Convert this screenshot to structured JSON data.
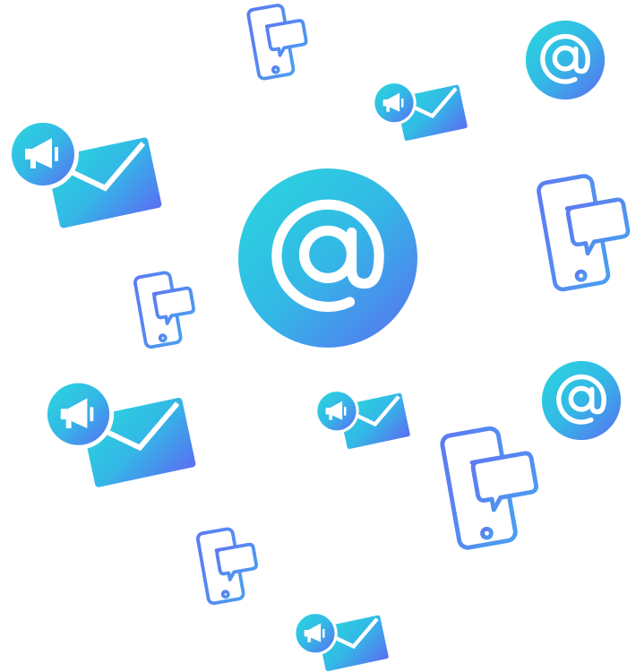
{
  "colors": {
    "gradient_start": "#2ad7de",
    "gradient_mid": "#33b8e6",
    "gradient_end": "#5a6ef2",
    "background": "#ffffff",
    "foreground": "#ffffff"
  },
  "icons": [
    "at-sign-icon",
    "email-marketing-icon",
    "phone-chat-icon"
  ],
  "at_symbol": "@"
}
